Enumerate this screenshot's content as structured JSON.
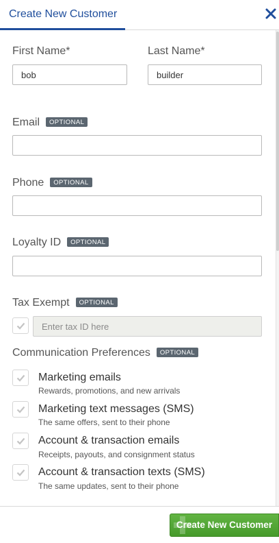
{
  "header": {
    "title": "Create New Customer"
  },
  "badge": "OPTIONAL",
  "form": {
    "first_name": {
      "label": "First Name*",
      "value": "bob"
    },
    "last_name": {
      "label": "Last Name*",
      "value": "builder"
    },
    "email": {
      "label": "Email",
      "value": ""
    },
    "phone": {
      "label": "Phone",
      "value": ""
    },
    "loyalty_id": {
      "label": "Loyalty ID",
      "value": ""
    },
    "tax_exempt": {
      "label": "Tax Exempt",
      "placeholder": "Enter tax ID here"
    }
  },
  "communication": {
    "title": "Communication Preferences",
    "items": [
      {
        "title": "Marketing emails",
        "subtitle": "Rewards, promotions, and new arrivals"
      },
      {
        "title": "Marketing text messages (SMS)",
        "subtitle": "The same offers, sent to their phone"
      },
      {
        "title": "Account & transaction emails",
        "subtitle": "Receipts, payouts, and consignment status"
      },
      {
        "title": "Account & transaction texts (SMS)",
        "subtitle": "The same updates, sent to their phone"
      }
    ]
  },
  "footer": {
    "submit_label": "Create New Customer"
  },
  "colors": {
    "accent": "#1f4e9c",
    "submit": "#52a637",
    "badge": "#5b6670"
  }
}
